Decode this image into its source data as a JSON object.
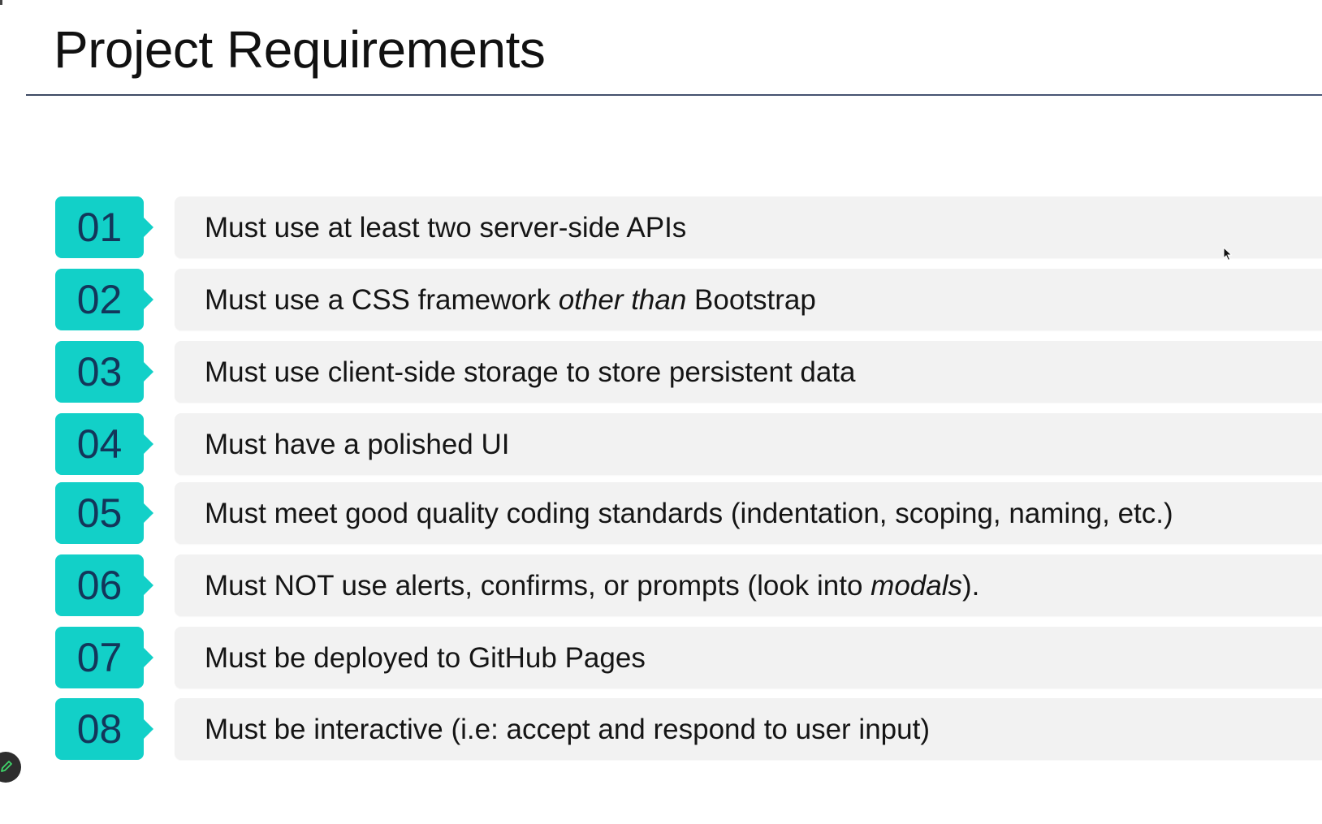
{
  "slide": {
    "title": "Project Requirements"
  },
  "requirements": [
    {
      "number": "01",
      "pre": "Must use at least two server-side APIs",
      "em": "",
      "post": ""
    },
    {
      "number": "02",
      "pre": "Must use a CSS framework ",
      "em": "other than",
      "post": " Bootstrap"
    },
    {
      "number": "03",
      "pre": "Must use client-side storage to store persistent data",
      "em": "",
      "post": ""
    },
    {
      "number": "04",
      "pre": "Must have a polished UI",
      "em": "",
      "post": ""
    },
    {
      "number": "05",
      "pre": "Must meet good quality coding standards (indentation, scoping, naming, etc.)",
      "em": "",
      "post": ""
    },
    {
      "number": "06",
      "pre": "Must NOT use alerts, confirms, or prompts (look into ",
      "em": "modals",
      "post": ")."
    },
    {
      "number": "07",
      "pre": "Must be deployed to GitHub Pages",
      "em": "",
      "post": ""
    },
    {
      "number": "08",
      "pre": "Must be interactive (i.e: accept and respond to user input)",
      "em": "",
      "post": ""
    }
  ],
  "colors": {
    "badge": "#12d0c8",
    "badge_text": "#13365a",
    "card": "#f2f2f2",
    "rule": "#3e4a63"
  },
  "icons": {
    "cursor": "mouse-pointer-icon",
    "annotate": "pencil-icon"
  }
}
